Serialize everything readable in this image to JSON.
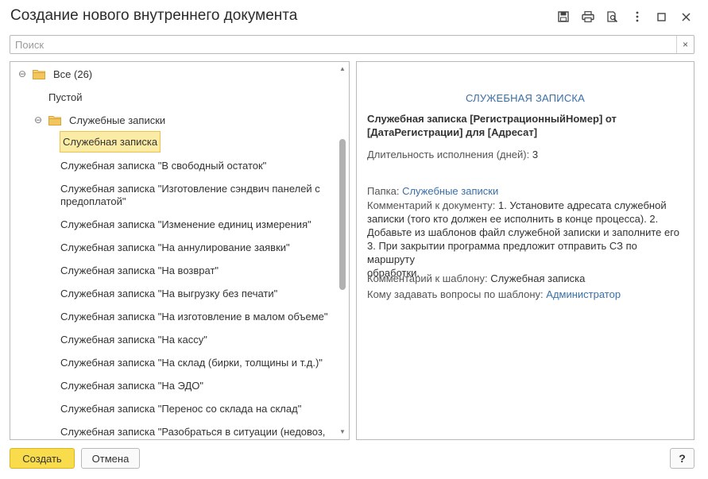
{
  "window": {
    "title": "Создание нового внутреннего документа",
    "icons": [
      "save-icon",
      "print-icon",
      "print-preview-icon",
      "more-icon",
      "maximize-icon",
      "close-icon"
    ]
  },
  "search": {
    "placeholder": "Поиск",
    "value": "",
    "clear_label": "×"
  },
  "tree": {
    "root": {
      "toggle": "⊖",
      "label": "Все (26)"
    },
    "empty_item": "Пустой",
    "folder": {
      "toggle": "⊖",
      "label": "Служебные записки"
    },
    "items": [
      "Служебная записка",
      "Служебная записка \"В свободный остаток\"",
      "Служебная записка \"Изготовление сэндвич панелей с",
      "предоплатой\"",
      "Служебная записка \"Изменение единиц измерения\"",
      "Служебная записка \"На аннулирование заявки\"",
      "Служебная записка \"На возврат\"",
      "Служебная записка \"На выгрузку без печати\"",
      "Служебная записка \"На изготовление в малом объеме\"",
      "Служебная записка \"На кассу\"",
      "Служебная записка \"На склад (бирки, толщины и т.д.)\"",
      "Служебная записка \"На ЭДО\"",
      "Служебная записка \"Перенос со склада на склад\"",
      "Служебная записка \"Разобраться в ситуации (недовоз,"
    ],
    "selected_index": 0,
    "scroll_position": 0.2
  },
  "preview": {
    "header": "СЛУЖЕБНАЯ ЗАПИСКА",
    "title_line1": "Служебная записка [РегистрационныйНомер] от",
    "title_line2": "[ДатаРегистрации] для [Адресат]",
    "duration_label": "Длительность исполнения (дней):",
    "duration_value": "3",
    "folder_label": "Папка:",
    "folder_value": "Служебные записки",
    "comment_doc_label": "Комментарий к документу:",
    "comment_doc_line1": "1. Установите адресата служебной",
    "comment_doc_line2": "записки (того кто должен ее исполнить в конце процесса). 2.",
    "comment_doc_line3": "Добавьте из шаблонов файл служебной записки и заполните его",
    "comment_doc_line4": "3. При закрытии программа предложит отправить СЗ по маршруту",
    "comment_doc_line5": "обработки.",
    "comment_tpl_label": "Комментарий к шаблону:",
    "comment_tpl_value": "Служебная записка",
    "questions_label": "Кому задавать вопросы по шаблону:",
    "questions_value": "Администратор"
  },
  "buttons": {
    "create": "Создать",
    "cancel": "Отмена",
    "help": "?"
  },
  "colors": {
    "accent_yellow": "#f9dc4c",
    "selection": "#fbeca5",
    "link": "#3a6fa8",
    "folder": "#e8b84a"
  }
}
